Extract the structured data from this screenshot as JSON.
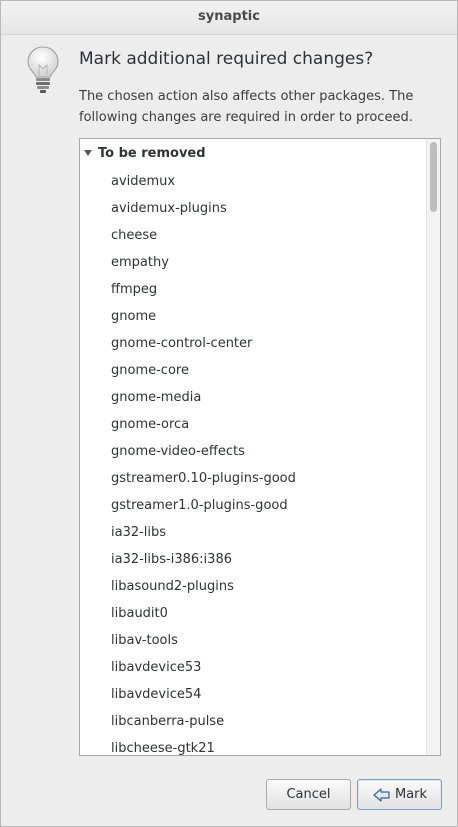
{
  "window": {
    "title": "synaptic"
  },
  "dialog": {
    "icon": "lightbulb-icon",
    "heading": "Mark additional required changes?",
    "description": "The chosen action also affects other packages. The following changes are required in order to proceed."
  },
  "list": {
    "group_label": "To be removed",
    "expander_icon": "triangle-down-icon",
    "items": [
      "avidemux",
      "avidemux-plugins",
      "cheese",
      "empathy",
      "ffmpeg",
      "gnome",
      "gnome-control-center",
      "gnome-core",
      "gnome-media",
      "gnome-orca",
      "gnome-video-effects",
      "gstreamer0.10-plugins-good",
      "gstreamer1.0-plugins-good",
      "ia32-libs",
      "ia32-libs-i386:i386",
      "libasound2-plugins",
      "libaudit0",
      "libav-tools",
      "libavdevice53",
      "libavdevice54",
      "libcanberra-pulse",
      "libcheese-gtk21"
    ]
  },
  "buttons": {
    "cancel_label": "Cancel",
    "mark_label": "Mark",
    "mark_icon": "mark-arrow-icon"
  }
}
